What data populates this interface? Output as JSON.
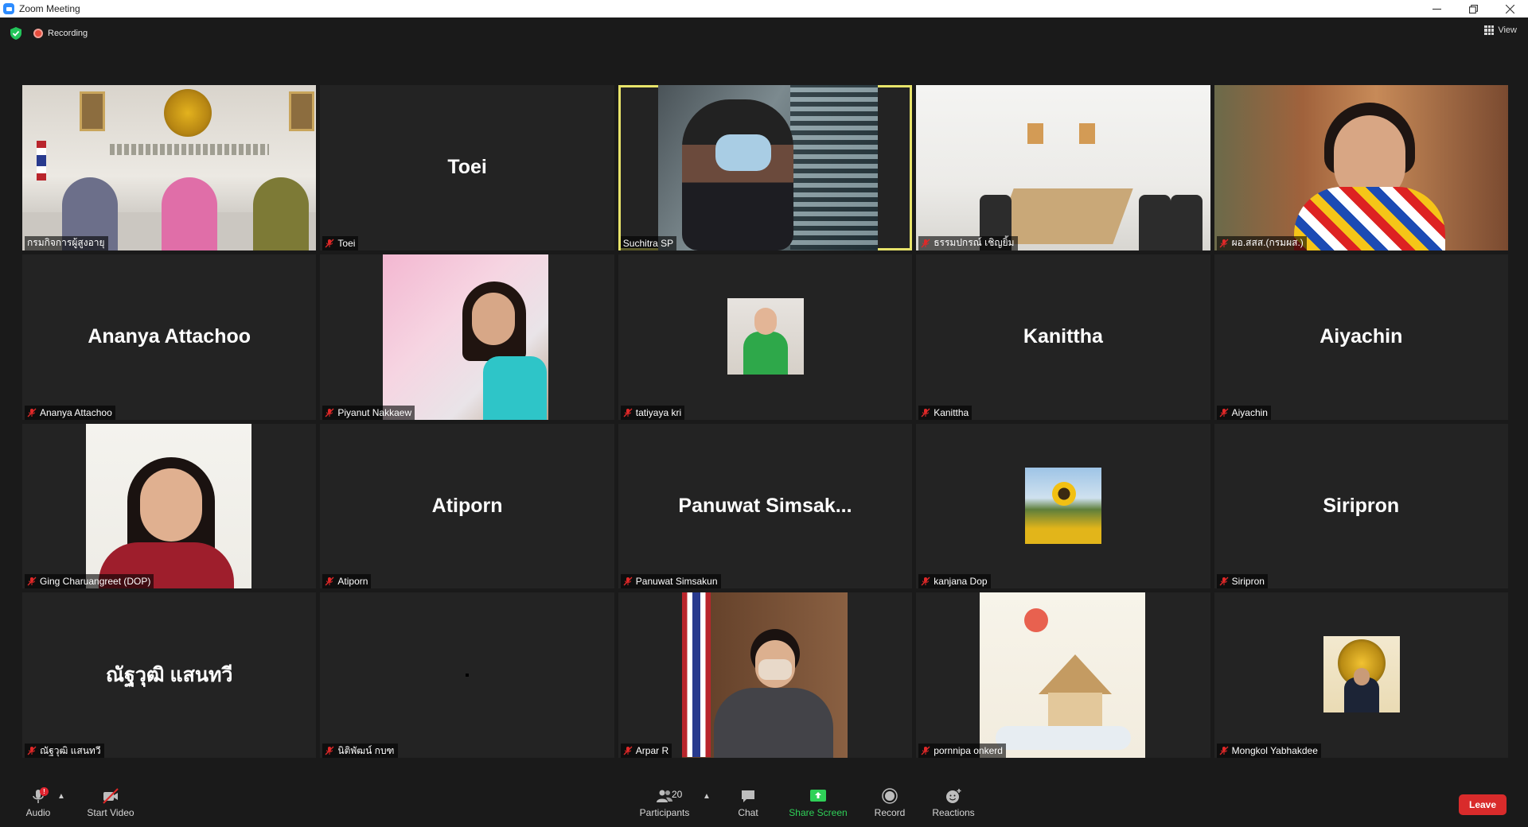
{
  "window": {
    "title": "Zoom Meeting"
  },
  "topbar": {
    "recording_label": "Recording",
    "view_label": "View"
  },
  "colors": {
    "active_speaker": "#e7e36a",
    "leave": "#d92b2b",
    "share": "#2fd158",
    "recording": "#e64c3c"
  },
  "tiles": [
    {
      "name": "กรมกิจการผู้สูงอายุ",
      "display": "",
      "video": true,
      "muted": false
    },
    {
      "name": "Toei",
      "display": "Toei",
      "video": false,
      "muted": true
    },
    {
      "name": "Suchitra SP",
      "display": "",
      "video": true,
      "muted": false,
      "active": true
    },
    {
      "name": "ธรรมปกรณ์ เชิญยิ้ม",
      "display": "",
      "video": true,
      "muted": true
    },
    {
      "name": "ผอ.สสส.(กรมผส.)",
      "display": "",
      "video": true,
      "muted": true
    },
    {
      "name": "Ananya Attachoo",
      "display": "Ananya Attachoo",
      "video": false,
      "muted": true
    },
    {
      "name": "Piyanut Nakkaew",
      "display": "",
      "video": true,
      "muted": true
    },
    {
      "name": "tatiyaya kri",
      "display": "",
      "video": true,
      "muted": true
    },
    {
      "name": "Kanittha",
      "display": "Kanittha",
      "video": false,
      "muted": true
    },
    {
      "name": "Aiyachin",
      "display": "Aiyachin",
      "video": false,
      "muted": true
    },
    {
      "name": "Ging Charuangreet (DOP)",
      "display": "",
      "video": true,
      "muted": true
    },
    {
      "name": "Atiporn",
      "display": "Atiporn",
      "video": false,
      "muted": true
    },
    {
      "name": "Panuwat Simsakun",
      "display": "Panuwat  Simsak...",
      "video": false,
      "muted": true
    },
    {
      "name": "kanjana Dop",
      "display": "",
      "video": true,
      "muted": true
    },
    {
      "name": "Siripron",
      "display": "Siripron",
      "video": false,
      "muted": true
    },
    {
      "name": "ณัฐวุฒิ แสนทวี",
      "display": "ณัฐวุฒิ แสนทวี",
      "video": false,
      "muted": true
    },
    {
      "name": "นิติพัฒน์ กบฑ",
      "display": "",
      "video": false,
      "muted": true
    },
    {
      "name": "Arpar R",
      "display": "",
      "video": true,
      "muted": true
    },
    {
      "name": "pornnipa onkerd",
      "display": "",
      "video": true,
      "muted": true
    },
    {
      "name": "Mongkol Yabhakdee",
      "display": "",
      "video": true,
      "muted": true
    }
  ],
  "toolbar": {
    "audio": "Audio",
    "audio_badge": "!",
    "start_video": "Start Video",
    "participants": "Participants",
    "participants_count": "20",
    "chat": "Chat",
    "share_screen": "Share Screen",
    "record": "Record",
    "reactions": "Reactions",
    "leave": "Leave"
  }
}
